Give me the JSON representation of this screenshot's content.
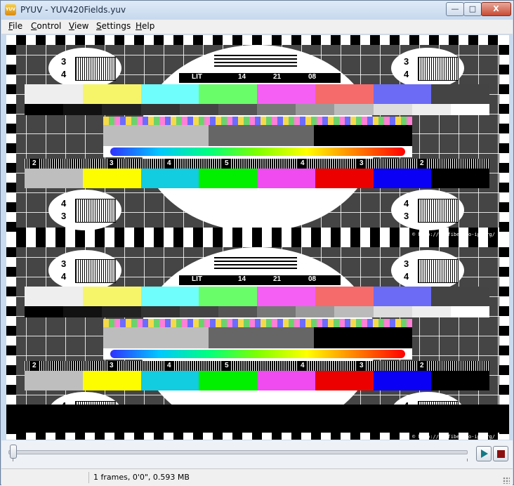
{
  "window": {
    "title": "PYUV - YUV420Fields.yuv",
    "icon": "pyuv-app-icon"
  },
  "window_controls": {
    "minimize": "—",
    "maximize": "□",
    "close": "X"
  },
  "menu": [
    {
      "label": "File"
    },
    {
      "label": "Control"
    },
    {
      "label": "View"
    },
    {
      "label": "Settings"
    },
    {
      "label": "Help"
    }
  ],
  "testpattern": {
    "label_lt": "LIT",
    "label_14": "14",
    "label_21": "21",
    "label_08": "08",
    "corner_top": "3",
    "corner_bottom": "4",
    "res_nums": [
      "2",
      "3",
      "4",
      "5",
      "4",
      "3",
      "2"
    ],
    "url": "© http://axofiber.no-ip.org/",
    "colors_top": [
      "#eeeeee",
      "#f6f56a",
      "#6ffefc",
      "#6afd6a",
      "#f55ff4",
      "#f56b6b",
      "#6b6bf6",
      "#444444"
    ],
    "colors_bottom": [
      "#bebebe",
      "#fdfd00",
      "#12ccdf",
      "#00f000",
      "#f04bf0",
      "#ec0000",
      "#0a00f6",
      "#000000"
    ],
    "gray_steps": [
      "#000",
      "#111",
      "#222",
      "#333",
      "#444",
      "#555",
      "#777",
      "#999",
      "#bbb",
      "#ddd",
      "#eee",
      "#fff"
    ]
  },
  "transport": {
    "play_icon": "play-icon",
    "stop_icon": "stop-icon",
    "position_fraction": 0.0
  },
  "status": {
    "text": "1 frames, 0'0\", 0.593 MB"
  }
}
